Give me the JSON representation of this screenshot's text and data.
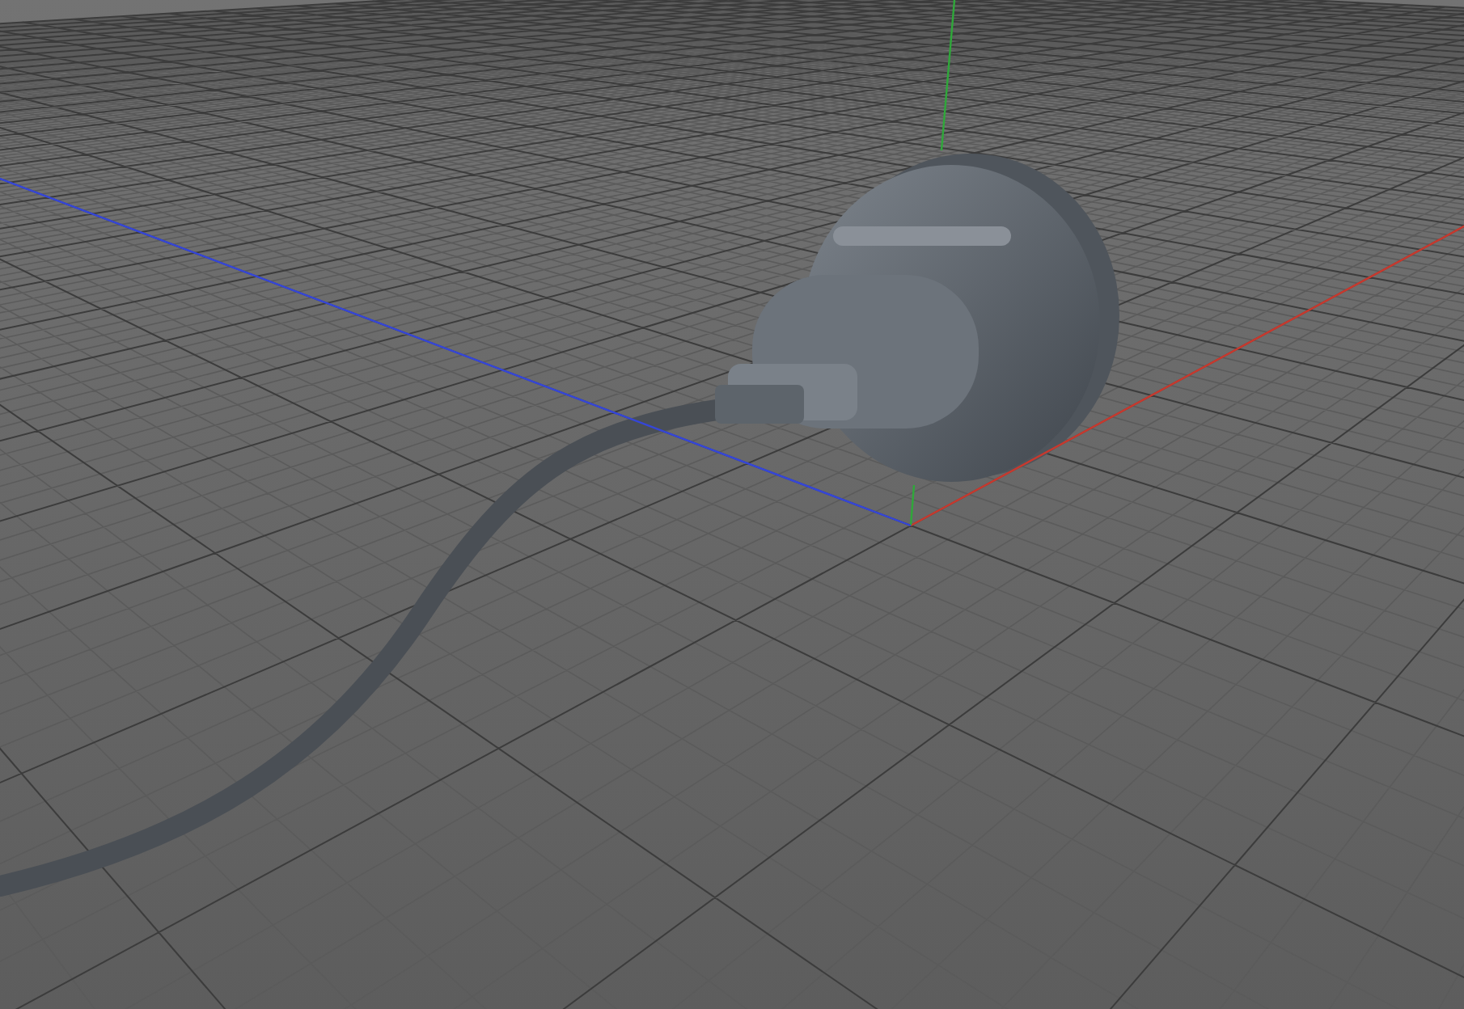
{
  "viewport": {
    "show_grid": true,
    "axes": [
      {
        "kind": "x",
        "color": "#c8392e"
      },
      {
        "kind": "y",
        "color": "#2fa83a"
      },
      {
        "kind": "z",
        "color": "#3546d8"
      }
    ]
  }
}
